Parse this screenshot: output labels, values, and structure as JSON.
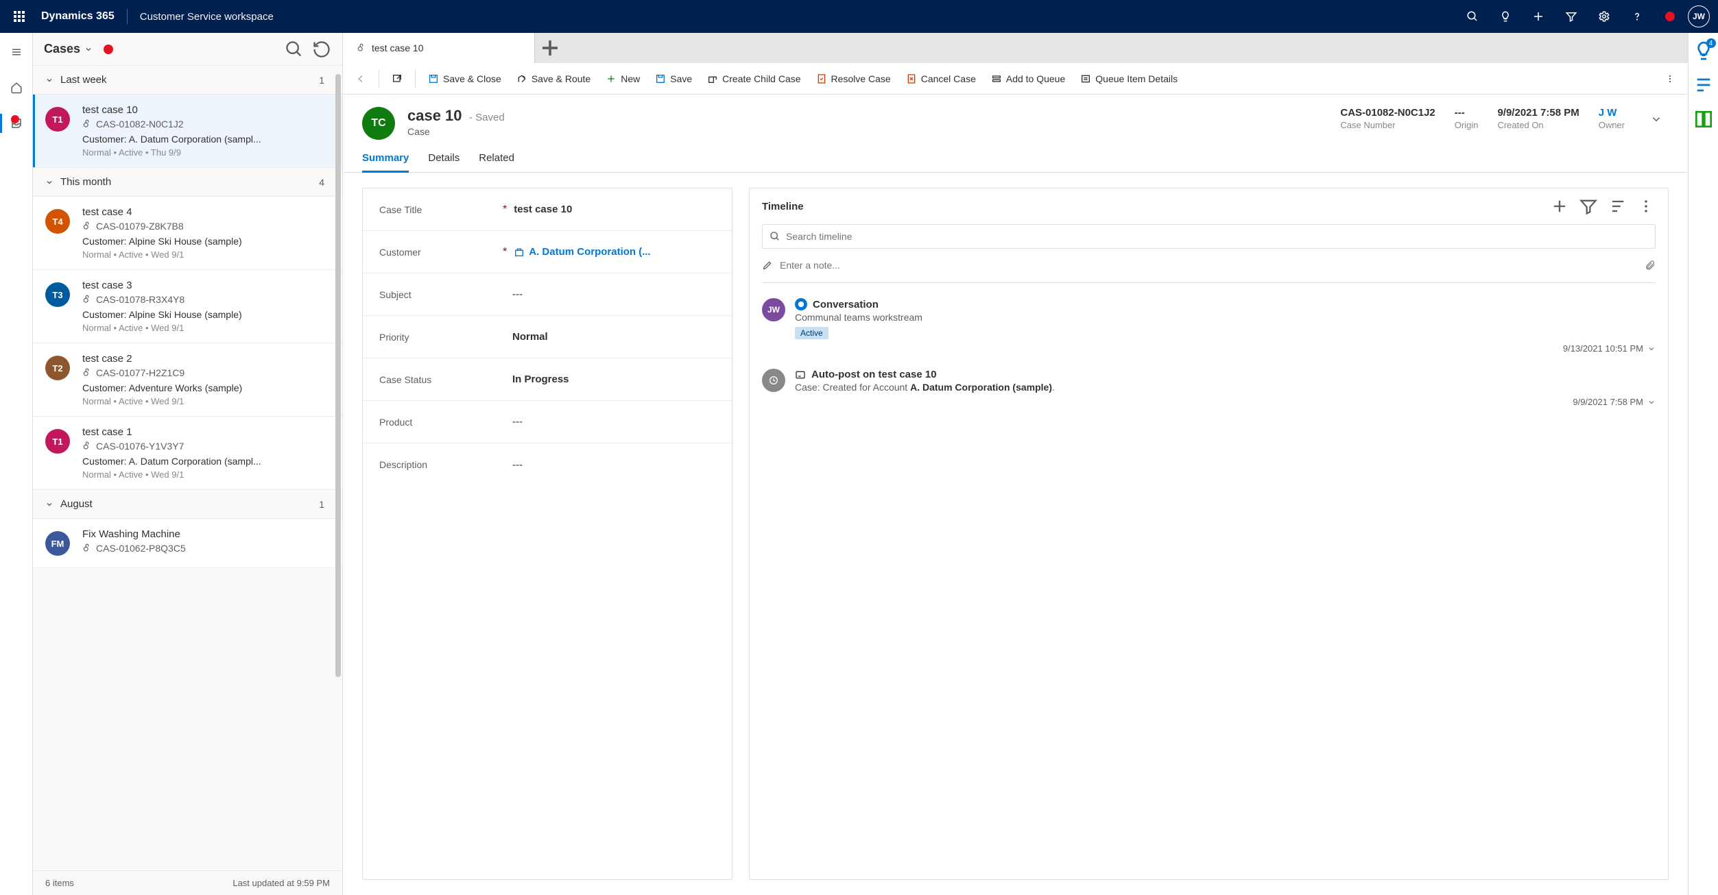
{
  "topbar": {
    "brand": "Dynamics 365",
    "workspace": "Customer Service workspace",
    "avatar_initials": "JW"
  },
  "session": {
    "title": "Cases",
    "footer_count": "6 items",
    "footer_updated": "Last updated at 9:59 PM",
    "groups": [
      {
        "label": "Last week",
        "count": "1",
        "items": [
          {
            "avatar": "T1",
            "avatar_color": "#c2185b",
            "title": "test case 10",
            "number": "CAS-01082-N0C1J2",
            "customer": "Customer: A. Datum Corporation (sampl...",
            "meta": "Normal • Active • Thu 9/9",
            "selected": true
          }
        ]
      },
      {
        "label": "This month",
        "count": "4",
        "items": [
          {
            "avatar": "T4",
            "avatar_color": "#d35400",
            "title": "test case 4",
            "number": "CAS-01079-Z8K7B8",
            "customer": "Customer: Alpine Ski House (sample)",
            "meta": "Normal • Active • Wed 9/1"
          },
          {
            "avatar": "T3",
            "avatar_color": "#005a9e",
            "title": "test case 3",
            "number": "CAS-01078-R3X4Y8",
            "customer": "Customer: Alpine Ski House (sample)",
            "meta": "Normal • Active • Wed 9/1"
          },
          {
            "avatar": "T2",
            "avatar_color": "#8e562e",
            "title": "test case 2",
            "number": "CAS-01077-H2Z1C9",
            "customer": "Customer: Adventure Works (sample)",
            "meta": "Normal • Active • Wed 9/1"
          },
          {
            "avatar": "T1",
            "avatar_color": "#c2185b",
            "title": "test case 1",
            "number": "CAS-01076-Y1V3Y7",
            "customer": "Customer: A. Datum Corporation (sampl...",
            "meta": "Normal • Active • Wed 9/1"
          }
        ]
      },
      {
        "label": "August",
        "count": "1",
        "items": [
          {
            "avatar": "FM",
            "avatar_color": "#3b5998",
            "title": "Fix Washing Machine",
            "number": "CAS-01062-P8Q3C5",
            "customer": "",
            "meta": ""
          }
        ]
      }
    ]
  },
  "tab": {
    "label": "test case 10"
  },
  "commands": {
    "save_close": "Save & Close",
    "save_route": "Save & Route",
    "new": "New",
    "save": "Save",
    "create_child": "Create Child Case",
    "resolve": "Resolve Case",
    "cancel": "Cancel Case",
    "add_queue": "Add to Queue",
    "queue_details": "Queue Item Details"
  },
  "record": {
    "avatar": "TC",
    "title": "case 10",
    "saved_label": "- Saved",
    "subtitle": "Case",
    "header_fields": [
      {
        "value": "CAS-01082-N0C1J2",
        "label": "Case Number"
      },
      {
        "value": "---",
        "label": "Origin"
      },
      {
        "value": "9/9/2021 7:58 PM",
        "label": "Created On"
      },
      {
        "value": "J W",
        "label": "Owner",
        "link": true
      }
    ],
    "tabs": [
      "Summary",
      "Details",
      "Related"
    ],
    "active_tab": 0,
    "fields": [
      {
        "label": "Case Title",
        "required": true,
        "value": "test case 10"
      },
      {
        "label": "Customer",
        "required": true,
        "value": "A. Datum Corporation (...",
        "link": true,
        "icon": true
      },
      {
        "label": "Subject",
        "value": "---",
        "dash": true
      },
      {
        "label": "Priority",
        "value": "Normal"
      },
      {
        "label": "Case Status",
        "value": "In Progress"
      },
      {
        "label": "Product",
        "value": "---",
        "dash": true
      },
      {
        "label": "Description",
        "value": "---",
        "dash": true
      }
    ]
  },
  "timeline": {
    "title": "Timeline",
    "search_placeholder": "Search timeline",
    "note_placeholder": "Enter a note...",
    "items": [
      {
        "avatar": "JW",
        "avatar_color": "#7b4ba0",
        "icon_color": "#0078d4",
        "title": "Conversation",
        "subtitle": "Communal teams workstream",
        "badge": "Active",
        "date": "9/13/2021 10:51 PM"
      },
      {
        "avatar": "",
        "avatar_color": "#8a8886",
        "avatar_icon": true,
        "title": "Auto-post on test case 10",
        "subtitle_pre": "Case: Created for Account ",
        "subtitle_bold": "A. Datum Corporation (sample)",
        "subtitle_post": ".",
        "date": "9/9/2021 7:58 PM"
      }
    ]
  },
  "right_rail_badge": "4"
}
